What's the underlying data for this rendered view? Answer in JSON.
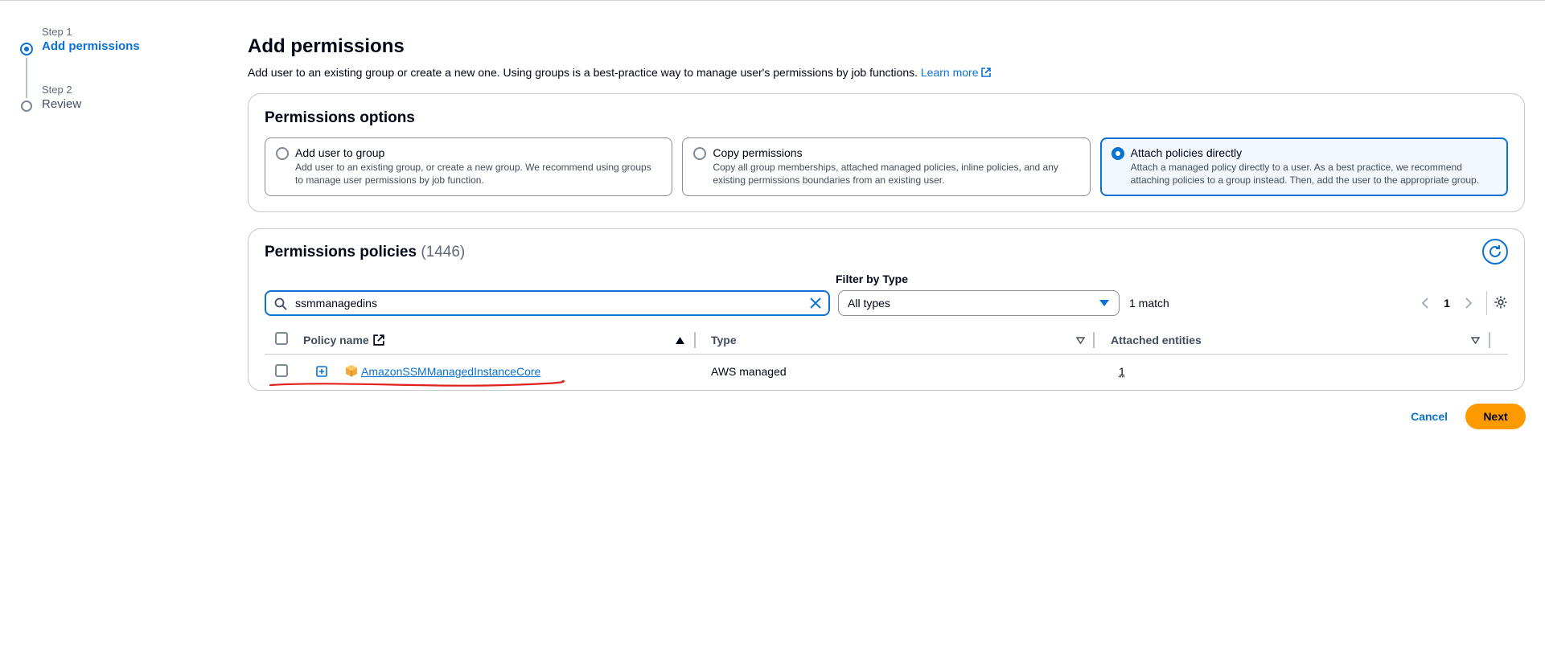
{
  "steps": [
    {
      "num": "Step 1",
      "title": "Add permissions"
    },
    {
      "num": "Step 2",
      "title": "Review"
    }
  ],
  "header": {
    "title": "Add permissions",
    "description": "Add user to an existing group or create a new one. Using groups is a best-practice way to manage user's permissions by job functions.",
    "learn_more": "Learn more"
  },
  "permissions_options": {
    "title": "Permissions options",
    "selected": "attach",
    "options": [
      {
        "title": "Add user to group",
        "desc1": "Add user to an existing group, or create a new group. We recommend using groups",
        "desc2": "to manage user permissions by job function."
      },
      {
        "title": "Copy permissions",
        "desc1": "Copy all group memberships, attached managed policies, inline policies, and any",
        "desc2": "existing permissions boundaries from an existing user."
      },
      {
        "title": "Attach policies directly",
        "desc1": "Attach a managed policy directly to a user. As a best practice, we recommend",
        "desc2": "attaching policies to a group instead. Then, add the user to the appropriate group."
      }
    ]
  },
  "policies": {
    "title": "Permissions policies",
    "count": "(1446)",
    "search_value": "ssmmanagedins",
    "filter_label": "Filter by Type",
    "filter_value": "All types",
    "match_text": "1 match",
    "page": "1",
    "columns": {
      "name": "Policy name",
      "type": "Type",
      "attached": "Attached entities"
    },
    "rows": [
      {
        "name": "AmazonSSMManagedInstanceCore",
        "type": "AWS managed",
        "attached": "1"
      }
    ]
  },
  "footer": {
    "cancel": "Cancel",
    "next": "Next"
  },
  "colors": {
    "accent": "#0972d3",
    "primary_button": "#ff9900",
    "annotation": "#e0201b"
  }
}
